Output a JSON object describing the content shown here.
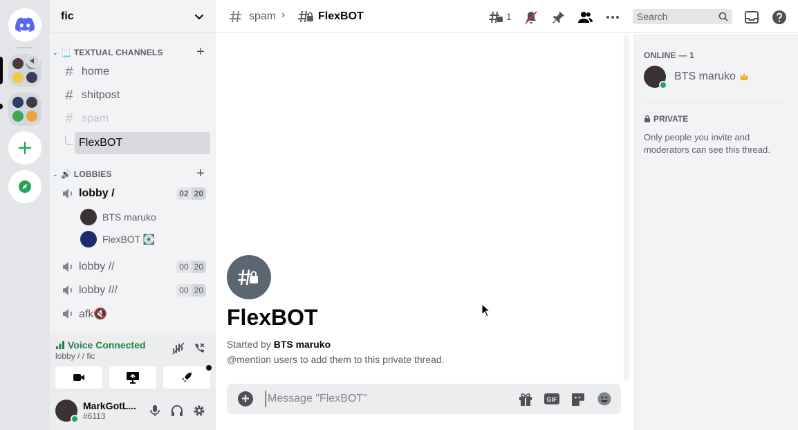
{
  "server": {
    "name": "fic"
  },
  "categories": [
    {
      "label": "📃 TEXTUAL CHANNELS"
    },
    {
      "label": "🔊 LOBBIES"
    }
  ],
  "text_channels": [
    {
      "name": "home"
    },
    {
      "name": "shitpost"
    },
    {
      "name": "spam"
    }
  ],
  "thread": {
    "name": "FlexBOT"
  },
  "voice_channels": [
    {
      "name": "lobby /",
      "count": "02",
      "limit": "20"
    },
    {
      "name": "lobby //",
      "count": "00",
      "limit": "20"
    },
    {
      "name": "lobby ///",
      "count": "00",
      "limit": "20"
    },
    {
      "name": "afk🔇"
    }
  ],
  "voice_users": [
    {
      "name": "BTS maruko"
    },
    {
      "name": "FlexBOT 💽"
    }
  ],
  "voice_panel": {
    "status": "Voice Connected",
    "location": "lobby / / fic"
  },
  "user": {
    "name": "MarkGotL...",
    "tag": "#6113"
  },
  "topbar": {
    "parent_channel": "spam",
    "thread_name": "FlexBOT",
    "threads_count": "1",
    "search_placeholder": "Search"
  },
  "chat": {
    "title": "FlexBOT",
    "started_prefix": "Started by",
    "started_by": "BTS maruko",
    "hint": "@mention users to add them to this private thread.",
    "composer_placeholder": "Message \"FlexBOT\""
  },
  "members": {
    "header": "ONLINE — 1",
    "list": [
      {
        "name": "BTS maruko",
        "badge": "crown-icon"
      }
    ],
    "private_header": "PRIVATE",
    "private_desc": "Only people you invite and moderators can see this thread."
  },
  "colors": {
    "online": "#23a559",
    "voice_green": "#248046",
    "crown": "#f0b232"
  }
}
